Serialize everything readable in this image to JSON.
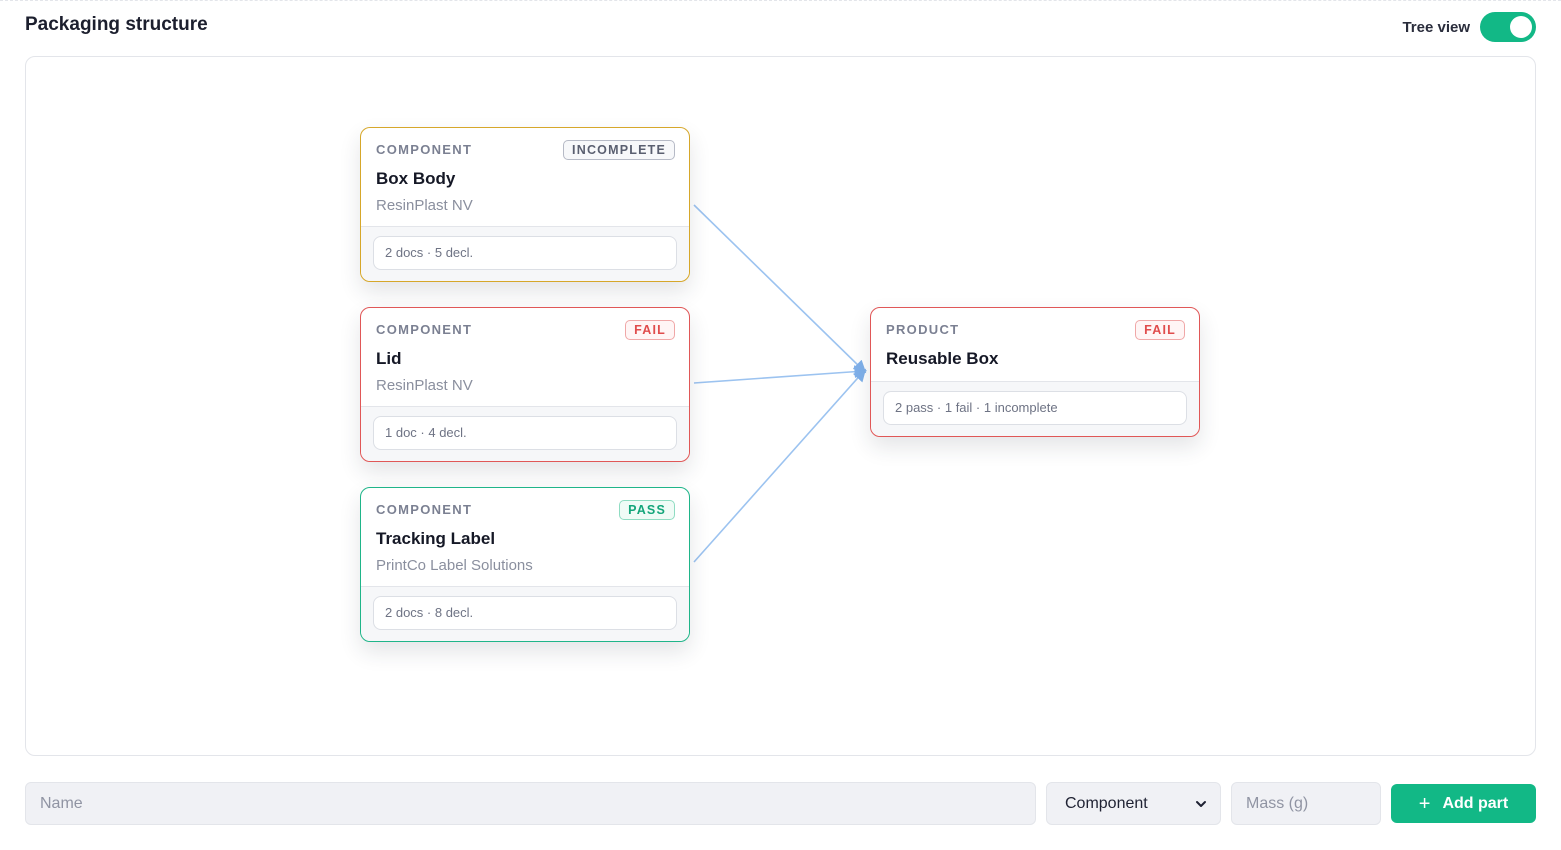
{
  "header": {
    "title": "Packaging structure",
    "tree_view_label": "Tree view",
    "tree_view_on": true
  },
  "colors": {
    "accent": "#12b886",
    "incomplete": "#d6a72a",
    "fail": "#e05757",
    "pass": "#1fb589",
    "edge": "#9cc3f0"
  },
  "nodes": [
    {
      "kind": "COMPONENT",
      "status": "INCOMPLETE",
      "name": "Box Body",
      "supplier": "ResinPlast NV",
      "summary": "2 docs · 5 decl."
    },
    {
      "kind": "COMPONENT",
      "status": "FAIL",
      "name": "Lid",
      "supplier": "ResinPlast NV",
      "summary": "1 doc · 4 decl."
    },
    {
      "kind": "COMPONENT",
      "status": "PASS",
      "name": "Tracking Label",
      "supplier": "PrintCo Label Solutions",
      "summary": "2 docs · 8 decl."
    },
    {
      "kind": "PRODUCT",
      "status": "FAIL",
      "name": "Reusable Box",
      "summary": "2 pass · 1 fail · 1 incomplete"
    }
  ],
  "form": {
    "name_placeholder": "Name",
    "type_selected": "Component",
    "mass_placeholder": "Mass (g)",
    "add_label": "Add part",
    "add_icon": "plus-icon"
  }
}
